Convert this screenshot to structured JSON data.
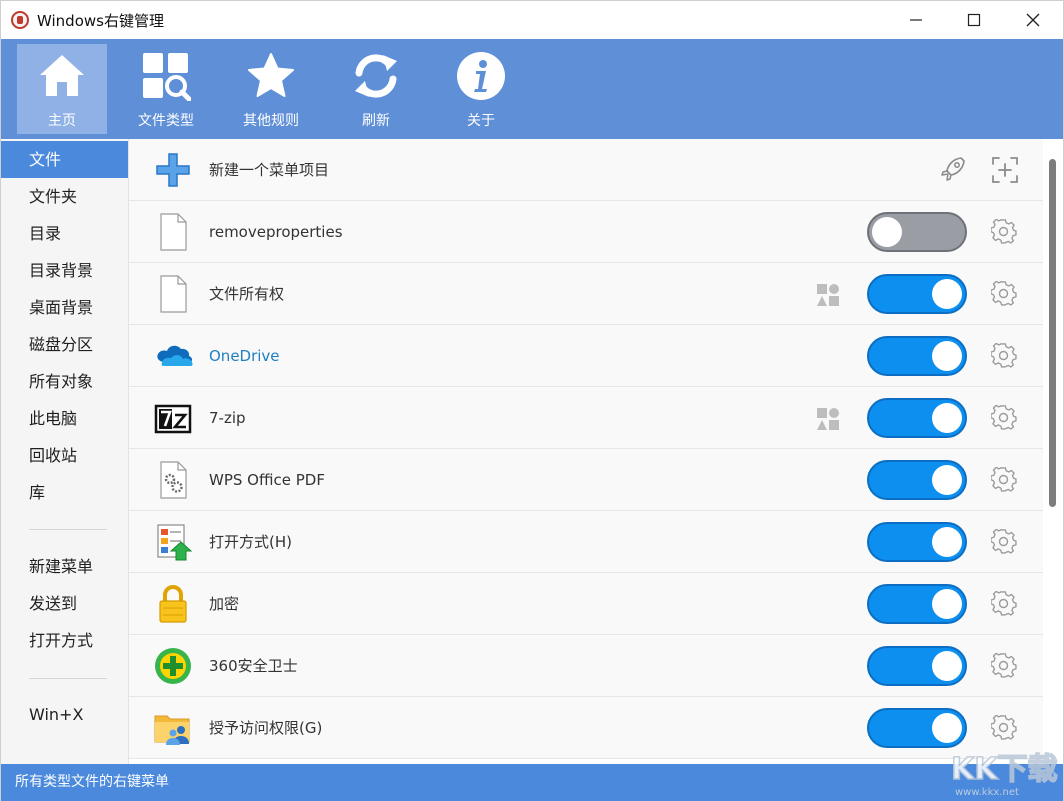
{
  "window": {
    "title": "Windows右键管理",
    "controls": [
      "minimize",
      "maximize",
      "close"
    ]
  },
  "toolbar": {
    "items": [
      {
        "label": "主页",
        "icon": "home-icon",
        "active": true
      },
      {
        "label": "文件类型",
        "icon": "file-type-grid-search-icon",
        "active": false
      },
      {
        "label": "其他规则",
        "icon": "star-icon",
        "active": false
      },
      {
        "label": "刷新",
        "icon": "refresh-icon",
        "active": false
      },
      {
        "label": "关于",
        "icon": "info-icon",
        "active": false
      }
    ]
  },
  "sidebar": {
    "group1": [
      "文件",
      "文件夹",
      "目录",
      "目录背景",
      "桌面背景",
      "磁盘分区",
      "所有对象",
      "此电脑",
      "回收站",
      "库"
    ],
    "group2": [
      "新建菜单",
      "发送到",
      "打开方式"
    ],
    "group3": [
      "Win+X"
    ],
    "active": "文件"
  },
  "list": {
    "new_item": {
      "label": "新建一个菜单项目",
      "icon": "plus-icon"
    },
    "rows": [
      {
        "label": "removeproperties",
        "icon": "blank-file-icon",
        "enabled": false,
        "shared": false
      },
      {
        "label": "文件所有权",
        "icon": "blank-file-icon",
        "enabled": true,
        "shared": true
      },
      {
        "label": "OneDrive",
        "icon": "onedrive-cloud-icon",
        "enabled": true,
        "shared": false
      },
      {
        "label": "7-zip",
        "icon": "7zip-icon",
        "enabled": true,
        "shared": true
      },
      {
        "label": "WPS Office PDF",
        "icon": "gear-file-icon",
        "enabled": true,
        "shared": false
      },
      {
        "label": "打开方式(H)",
        "icon": "open-with-icon",
        "enabled": true,
        "shared": false
      },
      {
        "label": "加密",
        "icon": "lock-icon",
        "enabled": true,
        "shared": false
      },
      {
        "label": "360安全卫士",
        "icon": "360-security-icon",
        "enabled": true,
        "shared": false
      },
      {
        "label": "授予访问权限(G)",
        "icon": "share-folder-icon",
        "enabled": true,
        "shared": false
      }
    ]
  },
  "statusbar": {
    "text": "所有类型文件的右键菜单"
  },
  "watermark": {
    "text": "KK下载",
    "url": "www.kkx.net"
  },
  "colors": {
    "toolbar": "#5f8fd6",
    "accent": "#4a89dc",
    "toggle_on": "#0d8ff0",
    "toggle_off": "#9a9ea4"
  }
}
